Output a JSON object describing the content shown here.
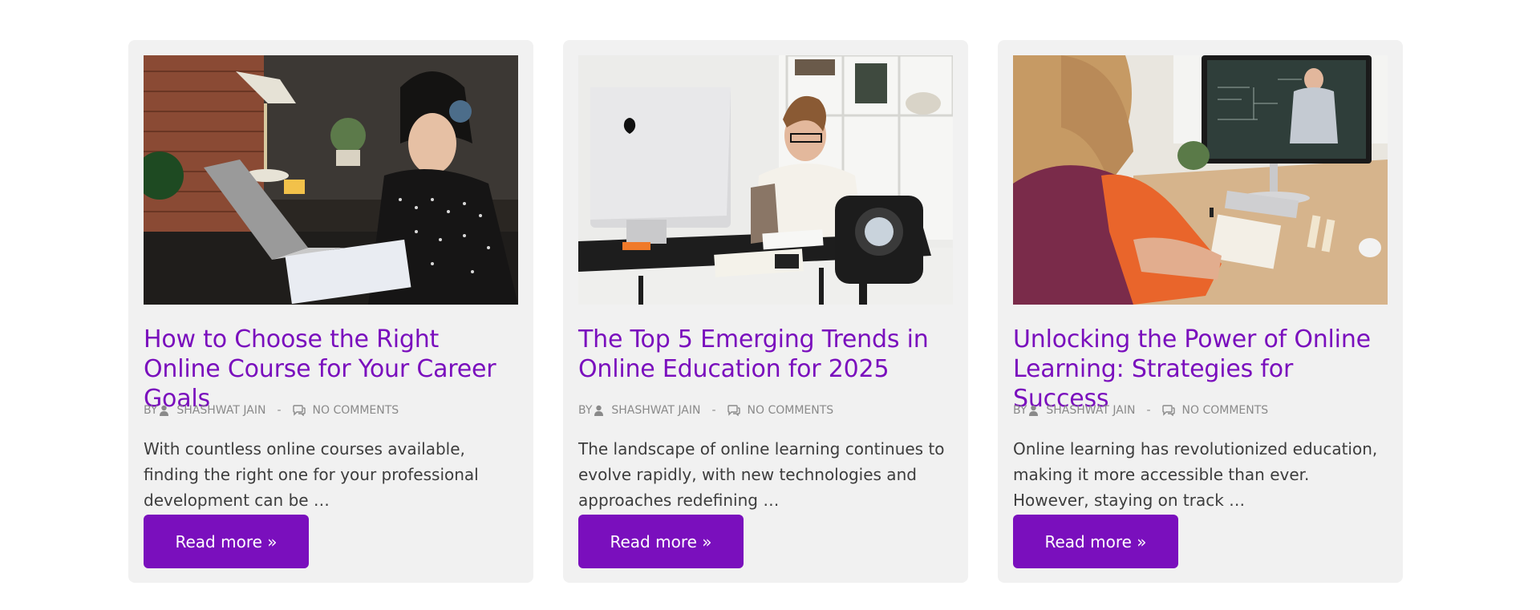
{
  "posts": [
    {
      "image_alt": "Woman with headphones typing on a laptop at a desk beside a brick wall",
      "title": "How to Choose the Right Online Course for Your Career Goals",
      "by": "BY",
      "author": "SHASHWAT JAIN",
      "separator": "-",
      "comments": "NO COMMENTS",
      "excerpt": "With countless online courses available, finding the right one for your professional development can be …",
      "button": "Read more »"
    },
    {
      "image_alt": "Woman at a desk with a desktop computer in front of a camera",
      "title": "The Top 5 Emerging Trends in Online Education for 2025",
      "by": "BY",
      "author": "SHASHWAT JAIN",
      "separator": "-",
      "comments": "NO COMMENTS",
      "excerpt": "The landscape of online learning continues to evolve rapidly, with new technologies and approaches redefining …",
      "button": "Read more »"
    },
    {
      "image_alt": "Student watching an online lecture on a desktop monitor",
      "title": "Unlocking the Power of Online Learning: Strategies for Success",
      "by": "BY",
      "author": "SHASHWAT JAIN",
      "separator": "-",
      "comments": "NO COMMENTS",
      "excerpt": "Online learning has revolutionized education, making it more accessible than ever. However, staying on track …",
      "button": "Read more »"
    }
  ],
  "icons": {
    "author": "user-icon",
    "comments": "comment-icon"
  },
  "colors": {
    "accent": "#7a0fbd",
    "card_bg": "#f1f1f1",
    "meta": "#8a8a8a",
    "text": "#3d3d3d"
  }
}
